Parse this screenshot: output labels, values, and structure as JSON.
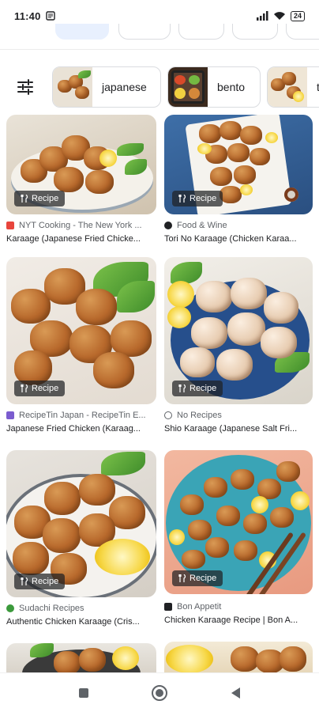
{
  "status": {
    "time": "11:40",
    "battery": "24"
  },
  "filters": {
    "chips": [
      {
        "label": "japanese"
      },
      {
        "label": "bento"
      },
      {
        "label": "t"
      }
    ]
  },
  "results": [
    {
      "badge": "Recipe",
      "source": "NYT Cooking - The New York ...",
      "title": "Karaage (Japanese Fried Chicke...",
      "favicon_color": "#e8453c"
    },
    {
      "badge": "Recipe",
      "source": "Food & Wine",
      "title": "Tori No Karaage (Chicken Karaa...",
      "favicon_color": "#202124"
    },
    {
      "badge": "Recipe",
      "source": "RecipeTin Japan - RecipeTin E...",
      "title": "Japanese Fried Chicken (Karaag...",
      "favicon_color": "#7b5ccf"
    },
    {
      "badge": "Recipe",
      "source": "No Recipes",
      "title": "Shio Karaage (Japanese Salt Fri...",
      "favicon_color": "#5f6368"
    },
    {
      "badge": "Recipe",
      "source": "Sudachi Recipes",
      "title": "Authentic Chicken Karaage (Cris...",
      "favicon_color": "#3c9a3c"
    },
    {
      "badge": "Recipe",
      "source": "Bon Appetit",
      "title": "Chicken Karaage Recipe | Bon A...",
      "favicon_color": "#202124"
    }
  ],
  "icons": {
    "filter": "tune-icon",
    "recipe": "fork-knife-icon",
    "nav_recents": "square-icon",
    "nav_home": "circle-icon",
    "nav_back": "triangle-back-icon"
  }
}
